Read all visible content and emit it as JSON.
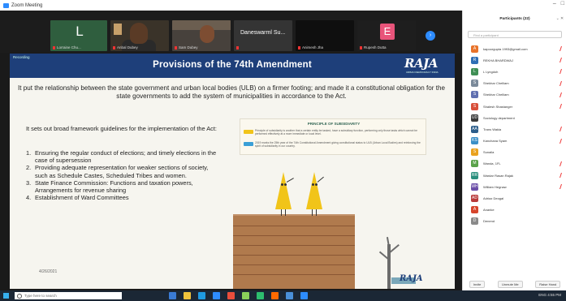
{
  "window": {
    "title": "Zoom Meeting"
  },
  "strip": {
    "tiles": [
      {
        "letter": "L",
        "name": "Lorraine Chu..."
      },
      {
        "name": "Anbal Dubey"
      },
      {
        "name": "Sam Dubey"
      },
      {
        "big": "Daneswarml Su...",
        "name": ""
      },
      {
        "name": "Animesh Jha"
      },
      {
        "letter": "E",
        "name": "Rupesh Dutta"
      }
    ]
  },
  "slide": {
    "sharing": "Recording",
    "title": "Provisions of the 74th Amendment",
    "logo": "RAJA",
    "logo_sub": "URBAN DEMOCRACY INDIA",
    "intro": "It put the relationship between the state government and urban local bodies  (ULB) on a firmer footing; and made it a constitutional obligation  for the state  governments to add the system of municipalities in accordance to the Act.",
    "framework": "It sets out broad framework  guidelines for the implementation  of the Act:",
    "items": [
      {
        "num": "1.",
        "text": "Ensuring the regular conduct of  elections; and timely elections  in the case of supersession"
      },
      {
        "num": "2.",
        "text": "Providing adequate  representation for weaker sections of society, such as Schedule Castes, Scheduled  Tribes and women."
      },
      {
        "num": "3.",
        "text": "State Finance Commission:  Functions and taxation powers, Arrangements for revenue  sharing"
      },
      {
        "num": "4.",
        "text": "Establishment of Ward Committees"
      }
    ],
    "date": "4/26/2021",
    "panel_title": "PRINCIPLE OF SUBSIDIARITY",
    "panel_text1": "Principle of subsidiarity is another that a certain entity be tasked, have a subsidiary function, performing only those tasks which cannot be performed effectively at a more immediate or local level.",
    "panel_text2": "2019 marks the 25th year of the 74th Constitutional Amendment giving constitutional status to ULB (Urban Local Bodies) and reinforcing the spirit of subsidiarity in our country."
  },
  "participants_panel": {
    "title": "Participants (22)",
    "search_placeholder": "Find a participant",
    "people": [
      {
        "initial": "A",
        "name": "kapoorgupta 1993@gmail.com",
        "color": "#e8732a",
        "muted": true
      },
      {
        "initial": "R",
        "name": "REKHA BHARDWAJ",
        "color": "#2f6eb5",
        "muted": true
      },
      {
        "initial": "L",
        "name": "L Lyngdoh",
        "color": "#3f8f55",
        "muted": true
      },
      {
        "initial": "S",
        "name": "Shekhar Chelliam",
        "color": "#7b8a9a",
        "muted": true
      },
      {
        "initial": "S",
        "name": "Shekhar Chelliam",
        "color": "#5f6fb0",
        "muted": true
      },
      {
        "initial": "S",
        "name": "Shalesh Shastanger",
        "color": "#d84f3a",
        "muted": true
      },
      {
        "initial": "UD",
        "name": "Sociology department",
        "color": "#3a3a3a",
        "muted": false
      },
      {
        "initial": "AA",
        "name": "Trans Wakia",
        "color": "#2c5d8a",
        "muted": true
      },
      {
        "initial": "KS",
        "name": "Kanchana Syam",
        "color": "#3b8fc7",
        "muted": true
      },
      {
        "initial": "S",
        "name": "Sunaila",
        "color": "#e9a21f",
        "muted": false
      },
      {
        "initial": "M",
        "name": "Wanda, 1FL",
        "color": "#5aa24a",
        "muted": true
      },
      {
        "initial": "RR",
        "name": "Wardar Rasan Rajak",
        "color": "#2a8f7d",
        "muted": true
      },
      {
        "initial": "WH",
        "name": "William Hegnaw",
        "color": "#6b4ea8",
        "muted": true
      },
      {
        "initial": "AD",
        "name": "Adriaz Deogal",
        "color": "#b83a3a",
        "muted": false
      },
      {
        "initial": "A",
        "name": "Ananke",
        "color": "#d6452c",
        "muted": false
      },
      {
        "initial": "D",
        "name": "Denend",
        "color": "#8a8a8a",
        "muted": false
      }
    ],
    "buttons": {
      "invite": "Invite",
      "mute_all": "Unmute Me",
      "raise": "Raise Hand"
    }
  },
  "taskbar": {
    "search_placeholder": "Type here to search",
    "tray": "ENG  4:55 PM",
    "apps": [
      "#3a7bd5",
      "#f0c33c",
      "#1f9ae0",
      "#2d8cff",
      "#e94e3c",
      "#8ad05a",
      "#2dbd6e",
      "#ff6a00",
      "#4a90d9",
      "#2d8cff"
    ]
  }
}
